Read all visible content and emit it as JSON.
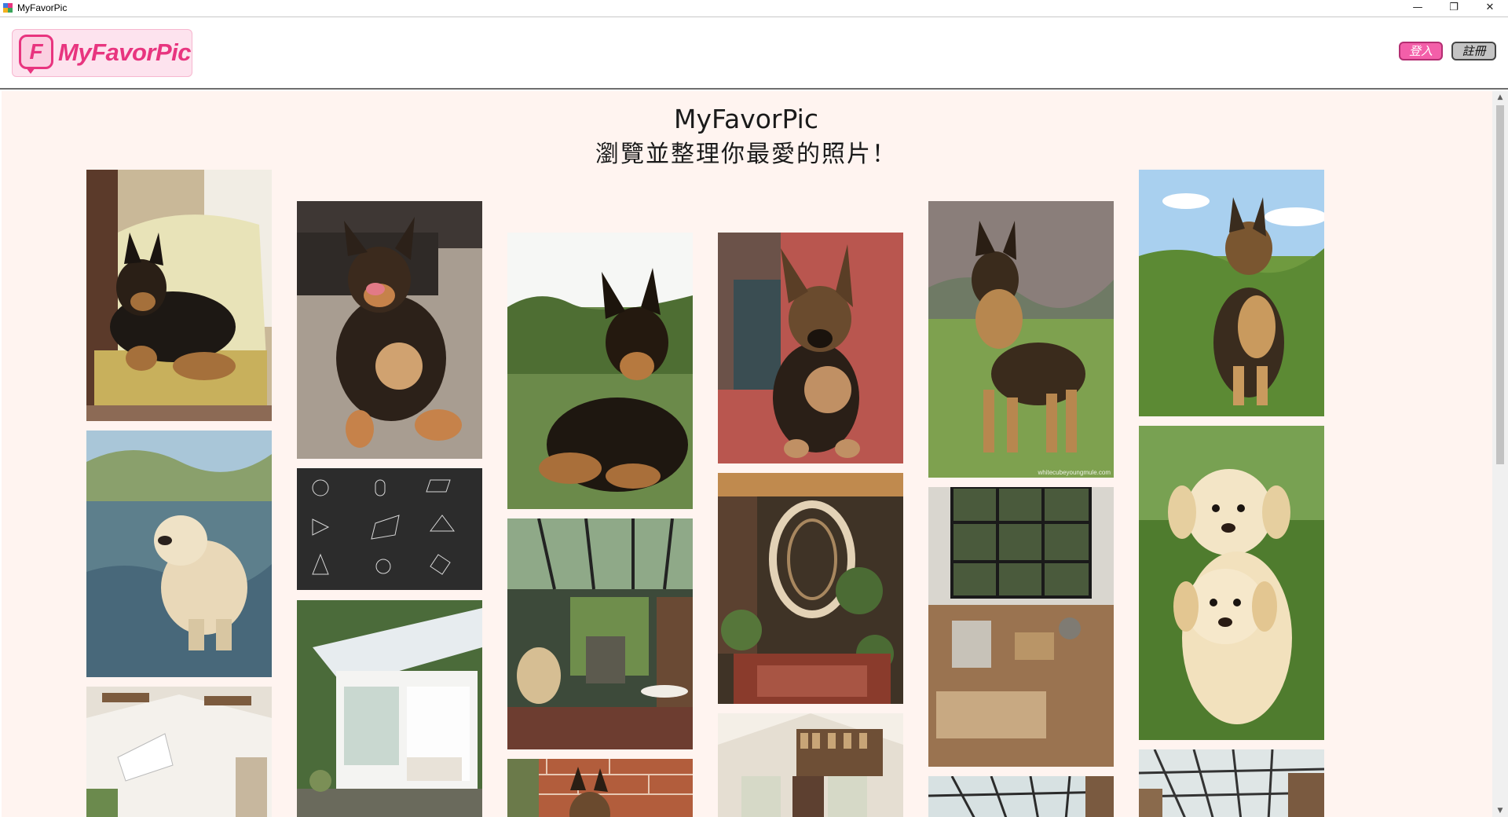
{
  "window": {
    "title": "MyFavorPic",
    "minimize_glyph": "—",
    "restore_glyph": "❐",
    "close_glyph": "✕"
  },
  "header": {
    "logo_letter": "F",
    "logo_text": "MyFavorPic",
    "login_label": "登入",
    "register_label": "註冊",
    "accent_color": "#e8357f"
  },
  "main": {
    "title": "MyFavorPic",
    "subtitle": "瀏覽並整理你最愛的照片！",
    "background_color": "#fff4f0",
    "photos": [
      {
        "subject": "german-shepherd-on-armchair",
        "column": 1
      },
      {
        "subject": "golden-retriever-puppy-in-stream",
        "column": 1
      },
      {
        "subject": "bright-attic-room",
        "column": 1
      },
      {
        "subject": "german-shepherd-puppy-smiling",
        "column": 2
      },
      {
        "subject": "chalkboard-geometry-formulas",
        "column": 2
      },
      {
        "subject": "white-greenhouse-bedroom",
        "column": 2
      },
      {
        "subject": "german-shepherd-lying-on-grass",
        "column": 3
      },
      {
        "subject": "greenhouse-conservatory-room",
        "column": 3
      },
      {
        "subject": "german-shepherd-by-brick-wall",
        "column": 3
      },
      {
        "subject": "german-shepherd-puppy-on-red-floor",
        "column": 4
      },
      {
        "subject": "spiral-staircase-plant-room",
        "column": 4
      },
      {
        "subject": "attic-library",
        "column": 4
      },
      {
        "subject": "german-shepherd-standing-on-grass",
        "column": 5
      },
      {
        "subject": "loft-living-room-with-tall-windows",
        "column": 5
      },
      {
        "subject": "glass-roof-library",
        "column": 5
      },
      {
        "subject": "german-shepherd-sitting-in-field",
        "column": 6
      },
      {
        "subject": "two-labrador-puppies",
        "column": 6
      },
      {
        "subject": "glass-roof-library-2",
        "column": 6
      }
    ],
    "photo_caption": "whitecubeyoungmule.com"
  },
  "scrollbar": {
    "up_glyph": "▲",
    "down_glyph": "▼"
  }
}
